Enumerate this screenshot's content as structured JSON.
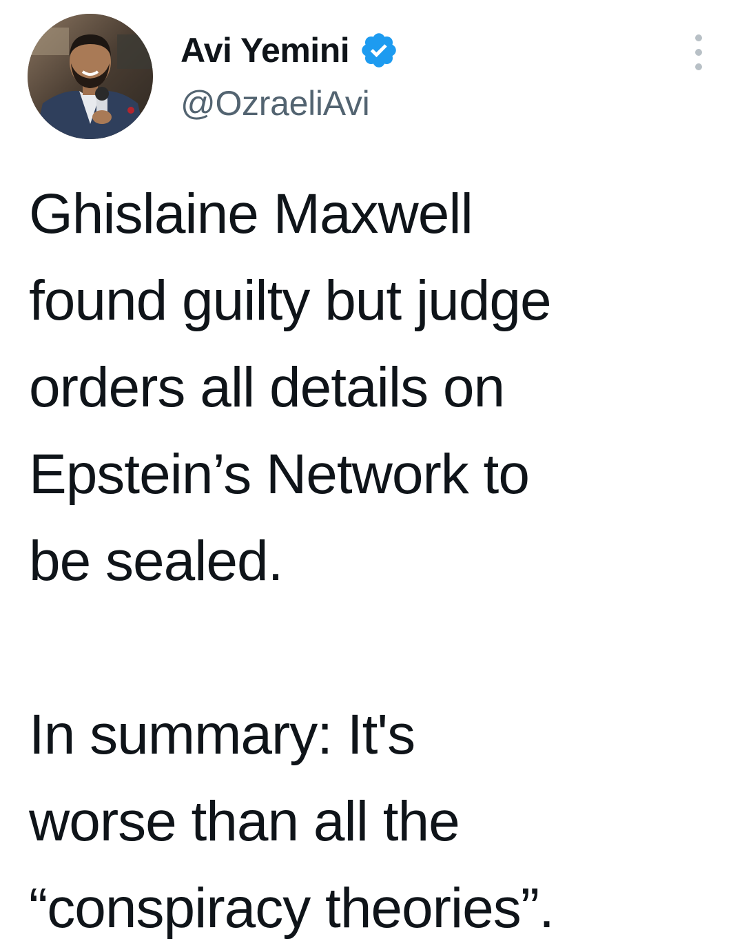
{
  "tweet": {
    "display_name": "Avi Yemini",
    "handle": "@OzraeliAvi",
    "verified": true,
    "more_icon": "more-options-icon",
    "text": "Ghislaine Maxwell\nfound guilty but judge\norders all details on\nEpstein’s Network to\nbe sealed.\n\nIn summary: It's\nworse than all the\n“conspiracy theories”.",
    "colors": {
      "verified_badge": "#1d9bf0",
      "handle": "#536471",
      "text": "#0f1419"
    }
  }
}
